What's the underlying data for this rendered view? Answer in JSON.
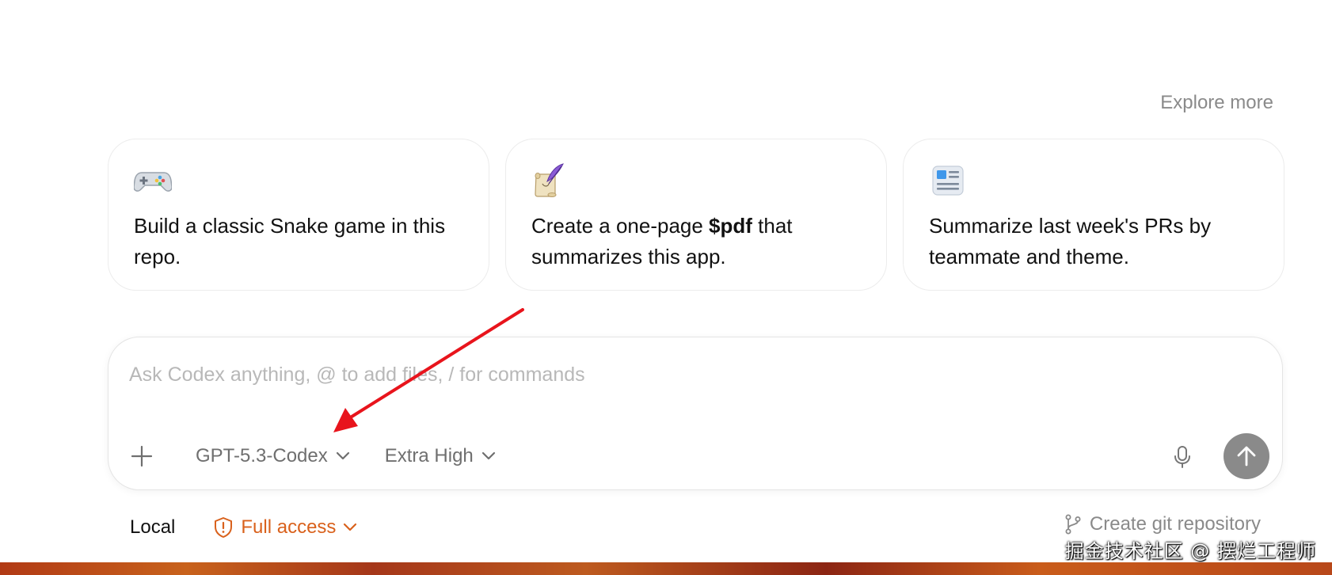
{
  "header": {
    "explore_more": "Explore more"
  },
  "cards": [
    {
      "icon": "gamepad-icon",
      "text_before": "Build a classic Snake game in this repo.",
      "bold": "",
      "text_after": ""
    },
    {
      "icon": "scroll-quill-icon",
      "text_before": "Create a one-page ",
      "bold": "$pdf",
      "text_after": " that summarizes this app."
    },
    {
      "icon": "newspaper-icon",
      "text_before": "Summarize last week's PRs by teammate and theme.",
      "bold": "",
      "text_after": ""
    }
  ],
  "composer": {
    "placeholder": "Ask Codex anything, @ to add files, / for commands",
    "model": "GPT-5.3-Codex",
    "reasoning": "Extra High"
  },
  "footer": {
    "location": "Local",
    "access": "Full access",
    "git": "Create git repository"
  },
  "watermark": "掘金技术社区 @ 摆烂工程师",
  "colors": {
    "access": "#d9611c",
    "send_button": "#8a8a8a",
    "annotation_arrow": "#e8141c"
  }
}
